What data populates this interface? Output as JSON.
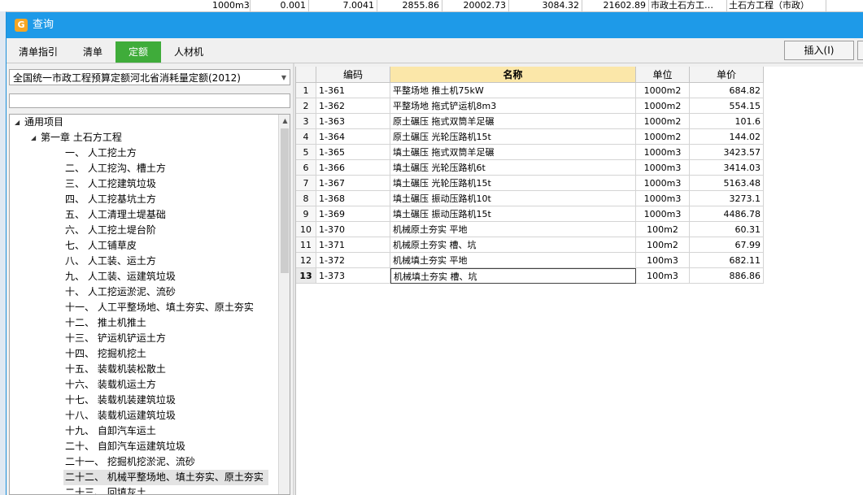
{
  "background_sheet": {
    "cells": [
      "1000m3",
      "0.001",
      "7.0041",
      "2855.86",
      "20002.73",
      "3084.32",
      "21602.89",
      "市政土石方工…",
      "土石方工程（市政）"
    ]
  },
  "dialog": {
    "title": "查询",
    "tabs": [
      "清单指引",
      "清单",
      "定额",
      "人材机"
    ],
    "active_tab_index": 2,
    "insert_button": "插入(I)",
    "colors": {
      "title_bar": "#1e9ae8",
      "active_tab": "#3fac3a",
      "header_highlight": "#fbe7a9"
    }
  },
  "left_panel": {
    "quota_library": "全国统一市政工程预算定额河北省消耗量定额(2012)",
    "search_value": "",
    "tree": [
      {
        "label": "通用项目",
        "level": 0,
        "expanded": true
      },
      {
        "label": "第一章 土石方工程",
        "level": 1,
        "expanded": true
      },
      {
        "label": "一、 人工挖土方",
        "level": 2
      },
      {
        "label": "二、 人工挖沟、槽土方",
        "level": 2
      },
      {
        "label": "三、 人工挖建筑垃圾",
        "level": 2
      },
      {
        "label": "四、 人工挖基坑土方",
        "level": 2
      },
      {
        "label": "五、 人工清理土堤基础",
        "level": 2
      },
      {
        "label": "六、 人工挖土堤台阶",
        "level": 2
      },
      {
        "label": "七、 人工铺草皮",
        "level": 2
      },
      {
        "label": "八、 人工装、运土方",
        "level": 2
      },
      {
        "label": "九、 人工装、运建筑垃圾",
        "level": 2
      },
      {
        "label": "十、 人工挖运淤泥、流砂",
        "level": 2
      },
      {
        "label": "十一、 人工平整场地、填土夯实、原土夯实",
        "level": 2
      },
      {
        "label": "十二、 推土机推土",
        "level": 2
      },
      {
        "label": "十三、 铲运机铲运土方",
        "level": 2
      },
      {
        "label": "十四、 挖掘机挖土",
        "level": 2
      },
      {
        "label": "十五、 装载机装松散土",
        "level": 2
      },
      {
        "label": "十六、 装载机运土方",
        "level": 2
      },
      {
        "label": "十七、 装载机装建筑垃圾",
        "level": 2
      },
      {
        "label": "十八、 装载机运建筑垃圾",
        "level": 2
      },
      {
        "label": "十九、 自卸汽车运土",
        "level": 2
      },
      {
        "label": "二十、 自卸汽车运建筑垃圾",
        "level": 2
      },
      {
        "label": "二十一、 挖掘机挖淤泥、流砂",
        "level": 2
      },
      {
        "label": "二十二、 机械平整场地、填土夯实、原土夯实",
        "level": 2,
        "selected": true
      },
      {
        "label": "二十三、 回填灰土",
        "level": 2
      }
    ]
  },
  "grid": {
    "columns": [
      "",
      "编码",
      "名称",
      "单位",
      "单价"
    ],
    "rows": [
      {
        "n": "1",
        "code": "1-361",
        "name": "平整场地 推土机75kW",
        "unit": "1000m2",
        "price": "684.82"
      },
      {
        "n": "2",
        "code": "1-362",
        "name": "平整场地 拖式铲运机8m3",
        "unit": "1000m2",
        "price": "554.15"
      },
      {
        "n": "3",
        "code": "1-363",
        "name": "原土碾压 拖式双筒羊足碾",
        "unit": "1000m2",
        "price": "101.6"
      },
      {
        "n": "4",
        "code": "1-364",
        "name": "原土碾压 光轮压路机15t",
        "unit": "1000m2",
        "price": "144.02"
      },
      {
        "n": "5",
        "code": "1-365",
        "name": "填土碾压 拖式双筒羊足碾",
        "unit": "1000m3",
        "price": "3423.57"
      },
      {
        "n": "6",
        "code": "1-366",
        "name": "填土碾压 光轮压路机6t",
        "unit": "1000m3",
        "price": "3414.03"
      },
      {
        "n": "7",
        "code": "1-367",
        "name": "填土碾压 光轮压路机15t",
        "unit": "1000m3",
        "price": "5163.48"
      },
      {
        "n": "8",
        "code": "1-368",
        "name": "填土碾压 振动压路机10t",
        "unit": "1000m3",
        "price": "3273.1"
      },
      {
        "n": "9",
        "code": "1-369",
        "name": "填土碾压 振动压路机15t",
        "unit": "1000m3",
        "price": "4486.78"
      },
      {
        "n": "10",
        "code": "1-370",
        "name": "机械原土夯实 平地",
        "unit": "100m2",
        "price": "60.31"
      },
      {
        "n": "11",
        "code": "1-371",
        "name": "机械原土夯实 槽、坑",
        "unit": "100m2",
        "price": "67.99"
      },
      {
        "n": "12",
        "code": "1-372",
        "name": "机械填土夯实 平地",
        "unit": "100m3",
        "price": "682.11"
      },
      {
        "n": "13",
        "code": "1-373",
        "name": "机械填土夯实 槽、坑",
        "unit": "100m3",
        "price": "886.86"
      }
    ],
    "selected_row": 12
  }
}
